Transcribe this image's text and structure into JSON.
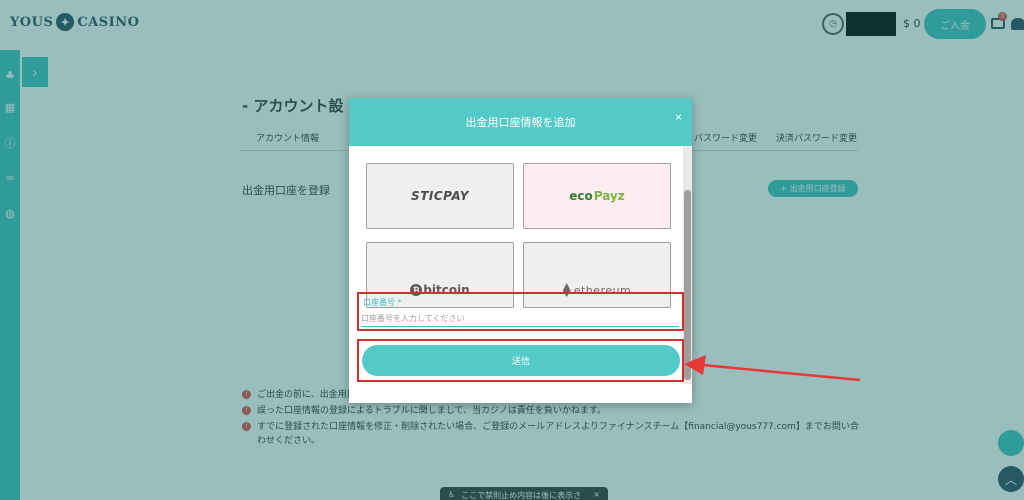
{
  "header": {
    "logo_left": "YOUS",
    "logo_right": "CASINO",
    "logo_mark": "✦",
    "balance": "$ 0",
    "deposit_label": "ご入金",
    "mail_badge": "0"
  },
  "page": {
    "title": "- アカウント設",
    "tabs": {
      "account_info": "アカウント情報",
      "password_change": "パスワード変更",
      "payment_password_change": "決済パスワード変更"
    },
    "section_label": "出金用口座を登録",
    "register_button": "+ 出金用口座登録",
    "notes": [
      "ご出金の前に、出金用口",
      "誤った口座情報の登録によるトラブルに関しまして、当カジノは責任を負いかねます。",
      "すでに登録された口座情報を修正・削除されたい場合、ご登録のメールアドレスよりファイナンスチーム【financial@yous777.com】までお問い合わせください。"
    ]
  },
  "modal": {
    "title": "出金用口座情報を追加",
    "close_label": "×",
    "payment_methods": [
      {
        "name": "STICPAY"
      },
      {
        "name": "ecoPayz",
        "part1": "eco",
        "part2": "Payz"
      },
      {
        "name": "bitcoin",
        "mark": "₿",
        "text": "bitcoin"
      },
      {
        "name": "ethereum",
        "text": "ethereum"
      }
    ],
    "account_field": {
      "label": "口座番号 *",
      "placeholder": "口座番号を入力してください",
      "value": ""
    },
    "submit_label": "送信"
  },
  "toast": {
    "icon": "♿",
    "text": "ここで禁則止め内容は後に表示されますか？",
    "close": "×"
  },
  "colors": {
    "accent": "#3fc1c0",
    "modal_header": "#53c9c8",
    "highlight_red": "#d32f2f"
  }
}
